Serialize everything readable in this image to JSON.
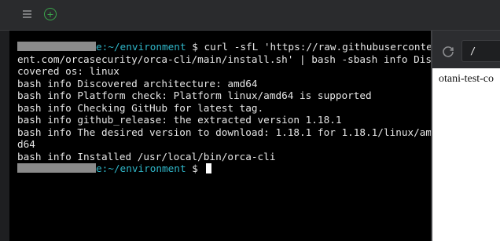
{
  "toolbar": {
    "menu_icon": "hamburger-icon",
    "new_tab_icon": "plus-circle-icon"
  },
  "terminal": {
    "prompt_path": "e:~/environment",
    "prompt_symbol": "$",
    "command_lines": [
      " curl -sfL 'https://raw.githubuserconte",
      "ent.com/orcasecurity/orca-cli/main/install.sh' | bash -sbash info Dis",
      "covered os: linux"
    ],
    "output_lines": [
      "bash info Discovered architecture: amd64",
      "bash info Platform check: Platform linux/amd64 is supported",
      "bash info Checking GitHub for latest tag.",
      "bash info github_release: the extracted version 1.18.1",
      "bash info The desired version to download: 1.18.1 for 1.18.1/linux/am",
      "d64",
      "bash info Installed /usr/local/bin/orca-cli"
    ]
  },
  "preview": {
    "refresh_icon": "refresh-icon",
    "url_value": "/",
    "page_text": "otani-test-co"
  },
  "colors": {
    "terminal_bg": "#000000",
    "path_color": "#2fb6c8",
    "accent_green": "#3aa64b"
  }
}
